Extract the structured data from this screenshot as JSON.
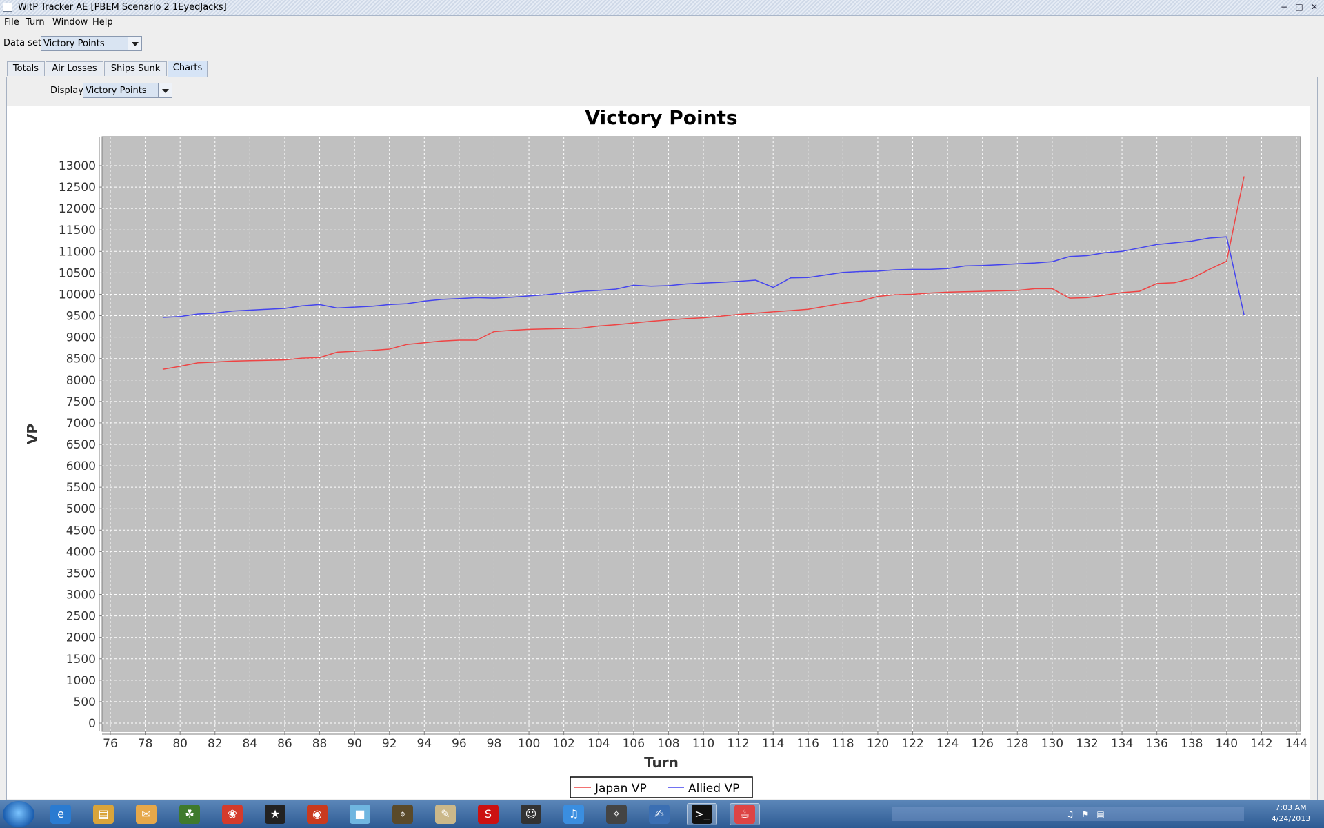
{
  "window": {
    "title": "WitP Tracker AE [PBEM Scenario 2 1EyedJacks]"
  },
  "menu": [
    "File",
    "Turn",
    "Window",
    "Help"
  ],
  "dataset": {
    "label": "Data set:",
    "value": "Victory Points"
  },
  "tabs": [
    "Totals",
    "Air Losses",
    "Ships Sunk",
    "Charts"
  ],
  "display": {
    "label": "Display:",
    "value": "Victory Points"
  },
  "chart_data": {
    "type": "line",
    "title": "Victory Points",
    "xlabel": "Turn",
    "ylabel": "VP",
    "xlim": [
      76,
      144
    ],
    "ylim": [
      0,
      13000
    ],
    "x_ticks": [
      76,
      78,
      80,
      82,
      84,
      86,
      88,
      90,
      92,
      94,
      96,
      98,
      100,
      102,
      104,
      106,
      108,
      110,
      112,
      114,
      116,
      118,
      120,
      122,
      124,
      126,
      128,
      130,
      132,
      134,
      136,
      138,
      140,
      142,
      144
    ],
    "y_ticks": [
      0,
      500,
      1000,
      1500,
      2000,
      2500,
      3000,
      3500,
      4000,
      4500,
      5000,
      5500,
      6000,
      6500,
      7000,
      7500,
      8000,
      8500,
      9000,
      9500,
      10000,
      10500,
      11000,
      11500,
      12000,
      12500,
      13000
    ],
    "grid": true,
    "legend_position": "bottom",
    "background": "#c0c0c0",
    "x": [
      79,
      80,
      81,
      82,
      83,
      84,
      85,
      86,
      87,
      88,
      89,
      90,
      91,
      92,
      93,
      94,
      95,
      96,
      97,
      98,
      99,
      100,
      101,
      102,
      103,
      104,
      105,
      106,
      107,
      108,
      109,
      110,
      111,
      112,
      113,
      114,
      115,
      116,
      117,
      118,
      119,
      120,
      121,
      122,
      123,
      124,
      125,
      126,
      127,
      128,
      129,
      130,
      131,
      132,
      133,
      134,
      135,
      136,
      137,
      138,
      139,
      140,
      141
    ],
    "series": [
      {
        "name": "Japan VP",
        "color": "#ee4444",
        "values": [
          8250,
          8320,
          8400,
          8420,
          8440,
          8450,
          8460,
          8470,
          8510,
          8520,
          8650,
          8670,
          8690,
          8720,
          8830,
          8870,
          8910,
          8930,
          8930,
          9130,
          9160,
          9180,
          9190,
          9200,
          9210,
          9260,
          9290,
          9330,
          9370,
          9400,
          9430,
          9450,
          9490,
          9530,
          9560,
          9590,
          9620,
          9650,
          9720,
          9790,
          9840,
          9950,
          9990,
          10000,
          10030,
          10050,
          10060,
          10070,
          10080,
          10090,
          10130,
          10130,
          9910,
          9920,
          9980,
          10040,
          10070,
          10250,
          10270,
          10370,
          10580,
          10770,
          12750
        ]
      },
      {
        "name": "Allied VP",
        "color": "#4444ee",
        "values": [
          9460,
          9480,
          9540,
          9560,
          9610,
          9630,
          9650,
          9670,
          9730,
          9760,
          9680,
          9700,
          9720,
          9760,
          9780,
          9840,
          9880,
          9900,
          9920,
          9910,
          9930,
          9960,
          9990,
          10030,
          10070,
          10090,
          10120,
          10210,
          10190,
          10200,
          10240,
          10260,
          10280,
          10300,
          10330,
          10160,
          10380,
          10390,
          10450,
          10510,
          10530,
          10540,
          10570,
          10580,
          10580,
          10600,
          10660,
          10670,
          10690,
          10710,
          10730,
          10760,
          10880,
          10900,
          10970,
          11000,
          11080,
          11160,
          11200,
          11240,
          11310,
          11340,
          9520
        ]
      }
    ]
  },
  "taskbar": {
    "clock_time": "7:03 AM",
    "clock_date": "4/24/2013",
    "apps": [
      "ie-icon",
      "folder-icon",
      "outlook-icon",
      "gecko-icon",
      "parrot-icon",
      "rank-icon",
      "game-icon",
      "notepad-icon",
      "map-icon",
      "paint-icon",
      "sins-icon",
      "general-icon",
      "itunes-icon",
      "oblivion-icon",
      "editor-icon",
      "console-icon",
      "java-icon"
    ]
  }
}
